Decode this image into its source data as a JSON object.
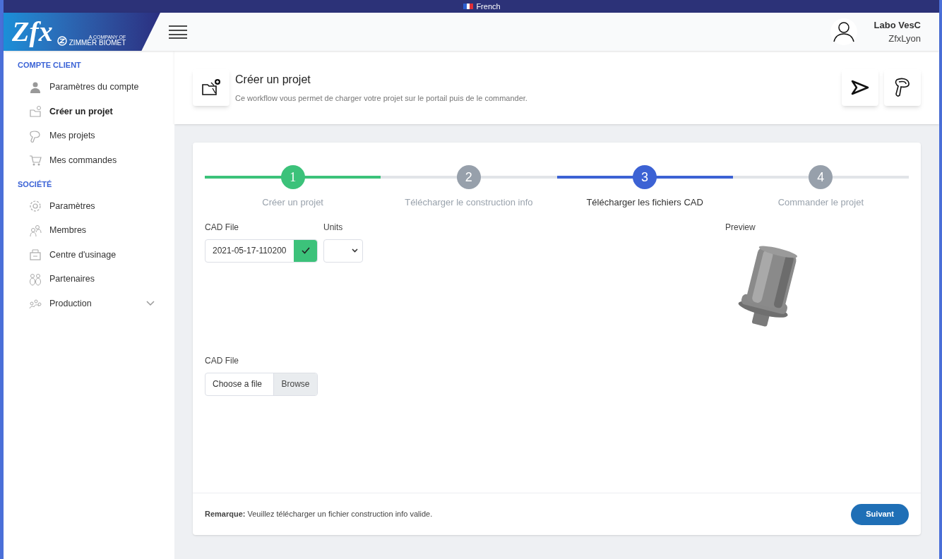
{
  "top_bar": {
    "language": "French"
  },
  "logo": {
    "brand": "Zfx",
    "tagline": "A COMPANY OF",
    "company": "ZIMMER BIOMET"
  },
  "user": {
    "name": "Labo VesC",
    "organization": "ZfxLyon"
  },
  "sidebar": {
    "sections": [
      {
        "title": "COMPTE CLIENT",
        "items": [
          {
            "label": "Paramètres du compte",
            "kind": "person",
            "selected": false
          },
          {
            "label": "Créer un projet",
            "kind": "folder",
            "selected": true
          },
          {
            "label": "Mes projets",
            "kind": "tooth",
            "selected": false
          },
          {
            "label": "Mes commandes",
            "kind": "cart",
            "selected": false
          }
        ]
      },
      {
        "title": "SOCIÉTÉ",
        "items": [
          {
            "label": "Paramètres",
            "kind": "gear",
            "selected": false
          },
          {
            "label": "Membres",
            "kind": "people",
            "selected": false
          },
          {
            "label": "Centre d'usinage",
            "kind": "machine",
            "selected": false
          },
          {
            "label": "Partenaires",
            "kind": "partners",
            "selected": false
          },
          {
            "label": "Production",
            "kind": "production",
            "selected": false,
            "expanded": false
          }
        ]
      }
    ]
  },
  "page_header": {
    "title": "Créer un projet",
    "subtitle": "Ce workflow vous permet de charger votre projet sur le portail puis de le commander."
  },
  "steps": [
    {
      "number": "1",
      "label": "Créer un projet",
      "completed": true,
      "selected": false
    },
    {
      "number": "2",
      "label": "Télécharger le construction info",
      "completed": false,
      "selected": false
    },
    {
      "number": "3",
      "label": "Télécharger les fichiers CAD",
      "completed": false,
      "selected": true
    },
    {
      "number": "4",
      "label": "Commander le projet",
      "completed": false,
      "selected": false
    }
  ],
  "form": {
    "cad_file_label": "CAD File",
    "cad_file_value": "2021-05-17-110200",
    "cad_file_valid": true,
    "units_label": "Units",
    "preview_label": "Preview",
    "upload_label": "CAD File",
    "upload_placeholder": "Choose a file",
    "browse_button": "Browse"
  },
  "footer": {
    "note": "**Remarque:** Veuillez télécharger un fichier construction info valide.",
    "next_button": "Suivant"
  }
}
